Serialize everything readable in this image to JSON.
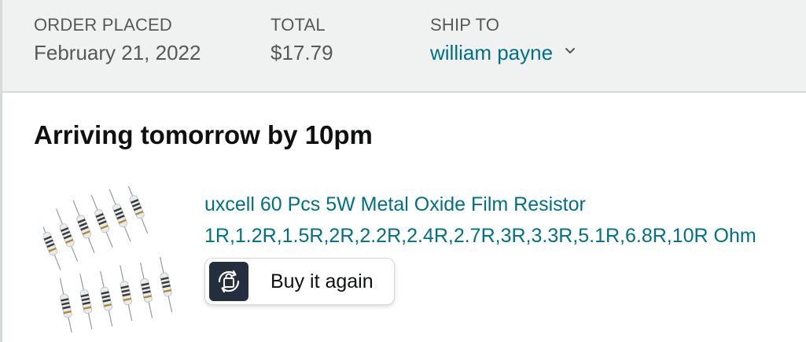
{
  "order_header": {
    "order_placed_label": "ORDER PLACED",
    "order_placed_value": "February 21, 2022",
    "total_label": "TOTAL",
    "total_value": "$17.79",
    "ship_to_label": "SHIP TO",
    "ship_to_value": "william payne",
    "ship_to_icon": "chevron-down-icon"
  },
  "shipment": {
    "status": "Arriving tomorrow by 10pm"
  },
  "item": {
    "title": "uxcell 60 Pcs 5W Metal Oxide Film Resistor 1R,1.2R,1.5R,2R,2.2R,2.4R,2.7R,3R,3.3R,5.1R,6.8R,10R Ohm",
    "buy_again_label": "Buy it again",
    "buy_again_icon": "buy-again-icon"
  },
  "colors": {
    "link": "#007185",
    "header_bg": "#f0f2f2",
    "muted_text": "#565959",
    "icon_bg": "#232f3e"
  }
}
